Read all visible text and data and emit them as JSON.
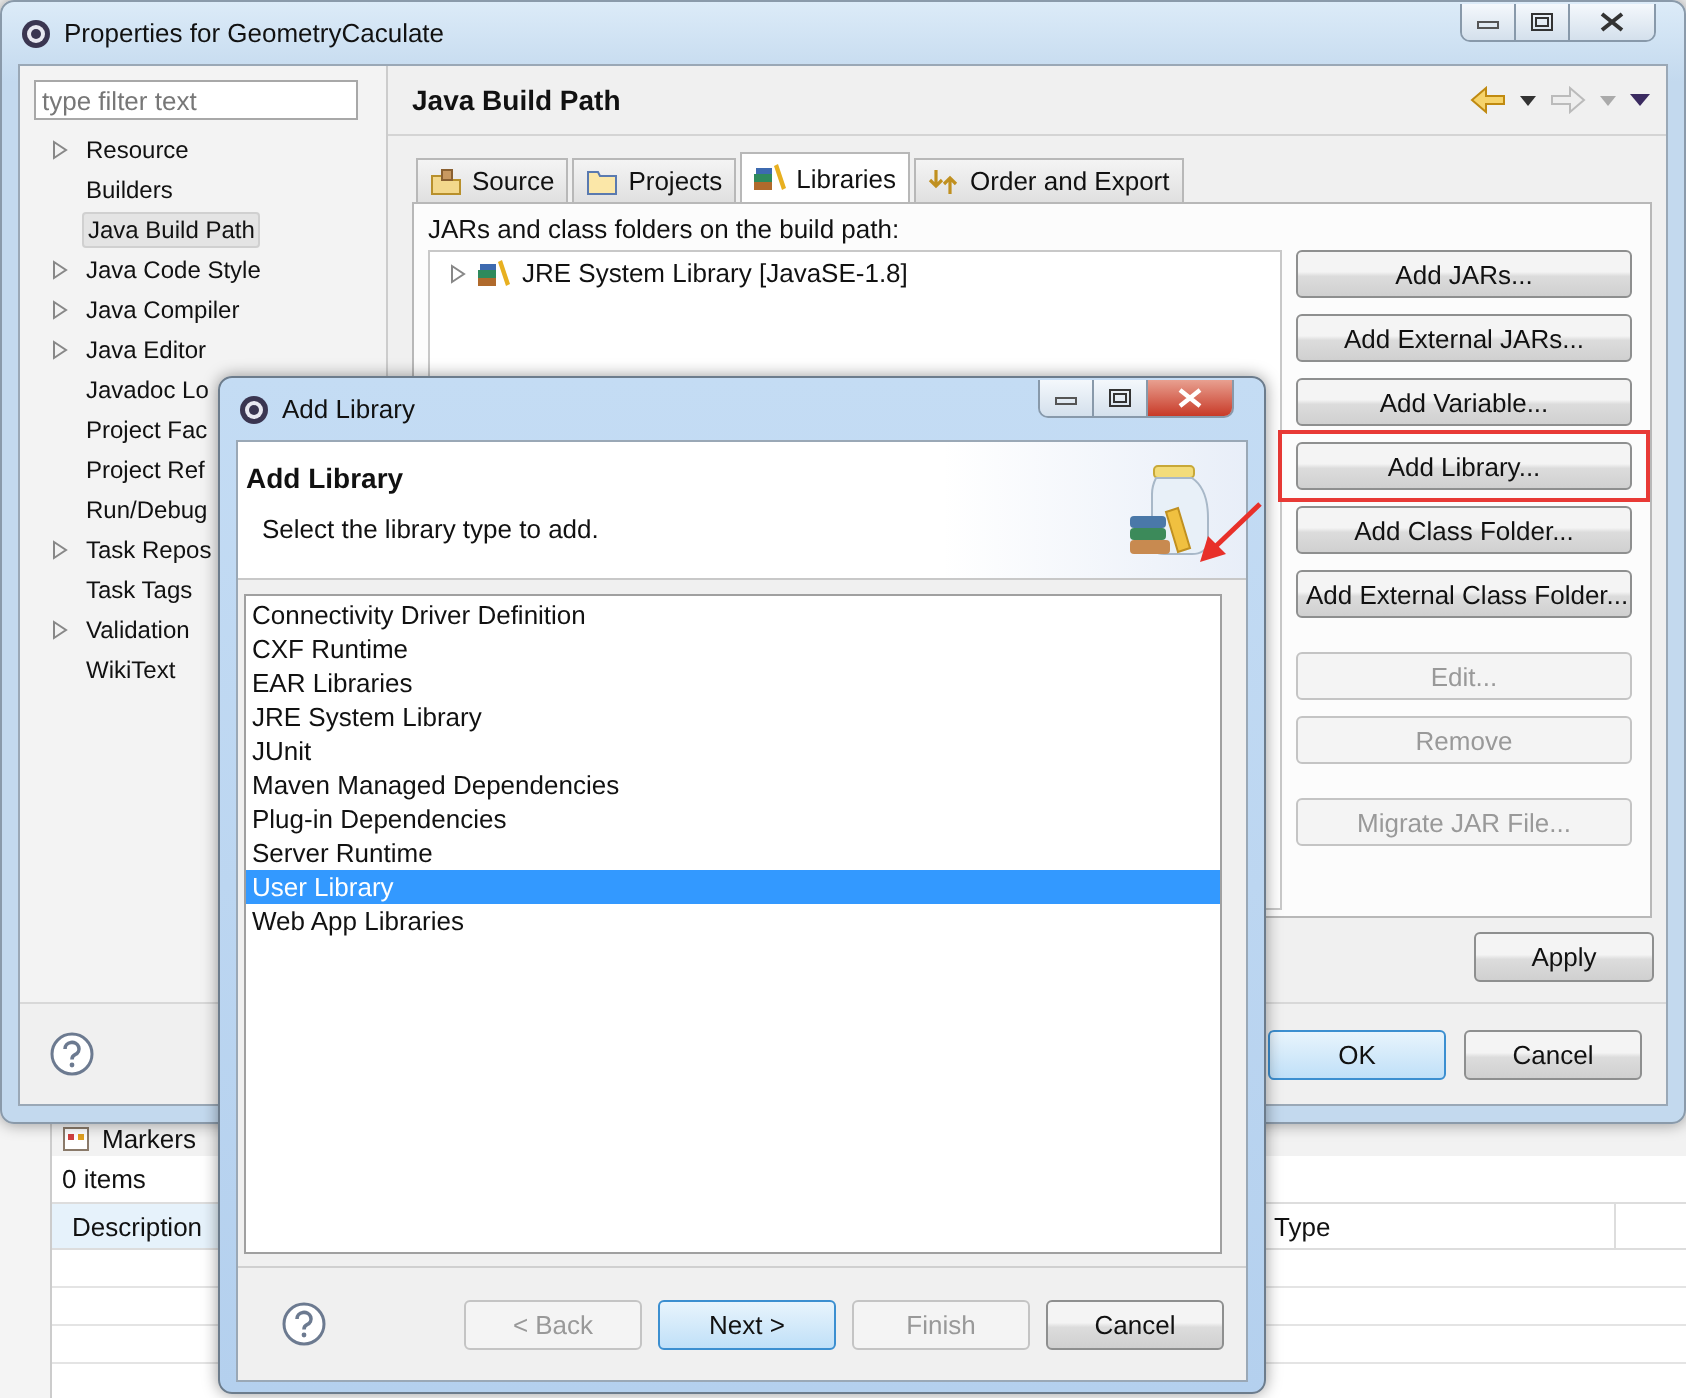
{
  "properties_window": {
    "title": "Properties for GeometryCaculate",
    "filter": {
      "placeholder": "type filter text"
    },
    "nav_items": [
      {
        "label": "Resource",
        "expandable": true,
        "selected": false
      },
      {
        "label": "Builders",
        "expandable": false,
        "selected": false
      },
      {
        "label": "Java Build Path",
        "expandable": false,
        "selected": true
      },
      {
        "label": "Java Code Style",
        "expandable": true,
        "selected": false
      },
      {
        "label": "Java Compiler",
        "expandable": true,
        "selected": false
      },
      {
        "label": "Java Editor",
        "expandable": true,
        "selected": false
      },
      {
        "label": "Javadoc Lo",
        "expandable": false,
        "selected": false
      },
      {
        "label": "Project Fac",
        "expandable": false,
        "selected": false
      },
      {
        "label": "Project Ref",
        "expandable": false,
        "selected": false
      },
      {
        "label": "Run/Debug",
        "expandable": false,
        "selected": false
      },
      {
        "label": "Task Repos",
        "expandable": true,
        "selected": false
      },
      {
        "label": "Task Tags",
        "expandable": false,
        "selected": false
      },
      {
        "label": "Validation",
        "expandable": true,
        "selected": false
      },
      {
        "label": "WikiText",
        "expandable": false,
        "selected": false
      }
    ],
    "page_title": "Java Build Path",
    "tabs": [
      {
        "label": "Source",
        "kind": "source",
        "selected": false
      },
      {
        "label": "Projects",
        "kind": "projects",
        "selected": false
      },
      {
        "label": "Libraries",
        "kind": "libraries",
        "selected": true
      },
      {
        "label": "Order and Export",
        "kind": "order",
        "selected": false
      }
    ],
    "build_path_label": "JARs and class folders on the build path:",
    "build_path_entries": [
      {
        "label": "JRE System Library [JavaSE-1.8]"
      }
    ],
    "side_button_groups": [
      [
        {
          "label": "Add JARs...",
          "disabled": false,
          "highlighted": false
        },
        {
          "label": "Add External JARs...",
          "disabled": false,
          "highlighted": false
        },
        {
          "label": "Add Variable...",
          "disabled": false,
          "highlighted": false
        },
        {
          "label": "Add Library...",
          "disabled": false,
          "highlighted": true
        },
        {
          "label": "Add Class Folder...",
          "disabled": false,
          "highlighted": false
        },
        {
          "label": "Add External Class Folder...",
          "disabled": false,
          "highlighted": false
        }
      ],
      [
        {
          "label": "Edit...",
          "disabled": true,
          "highlighted": false
        },
        {
          "label": "Remove",
          "disabled": true,
          "highlighted": false
        }
      ],
      [
        {
          "label": "Migrate JAR File...",
          "disabled": true,
          "highlighted": false
        }
      ]
    ],
    "apply": "Apply",
    "buttons": [
      {
        "label": "OK",
        "default": true
      },
      {
        "label": "Cancel",
        "default": false
      }
    ]
  },
  "markers_view": {
    "tab": "Markers",
    "count": "0 items",
    "columns": [
      "Description",
      "Type"
    ]
  },
  "add_library_dialog": {
    "title": "Add Library",
    "heading": "Add Library",
    "description": "Select the library type to add.",
    "library_types": [
      {
        "label": "Connectivity Driver Definition",
        "selected": false
      },
      {
        "label": "CXF Runtime",
        "selected": false
      },
      {
        "label": "EAR Libraries",
        "selected": false
      },
      {
        "label": "JRE System Library",
        "selected": false
      },
      {
        "label": "JUnit",
        "selected": false
      },
      {
        "label": "Maven Managed Dependencies",
        "selected": false
      },
      {
        "label": "Plug-in Dependencies",
        "selected": false
      },
      {
        "label": "Server Runtime",
        "selected": false
      },
      {
        "label": "User Library",
        "selected": true
      },
      {
        "label": "Web App Libraries",
        "selected": false
      }
    ],
    "buttons": [
      {
        "label": "< Back",
        "disabled": true,
        "default": false
      },
      {
        "label": "Next >",
        "disabled": false,
        "default": true
      },
      {
        "label": "Finish",
        "disabled": true,
        "default": false
      },
      {
        "label": "Cancel",
        "disabled": false,
        "default": false
      }
    ]
  }
}
